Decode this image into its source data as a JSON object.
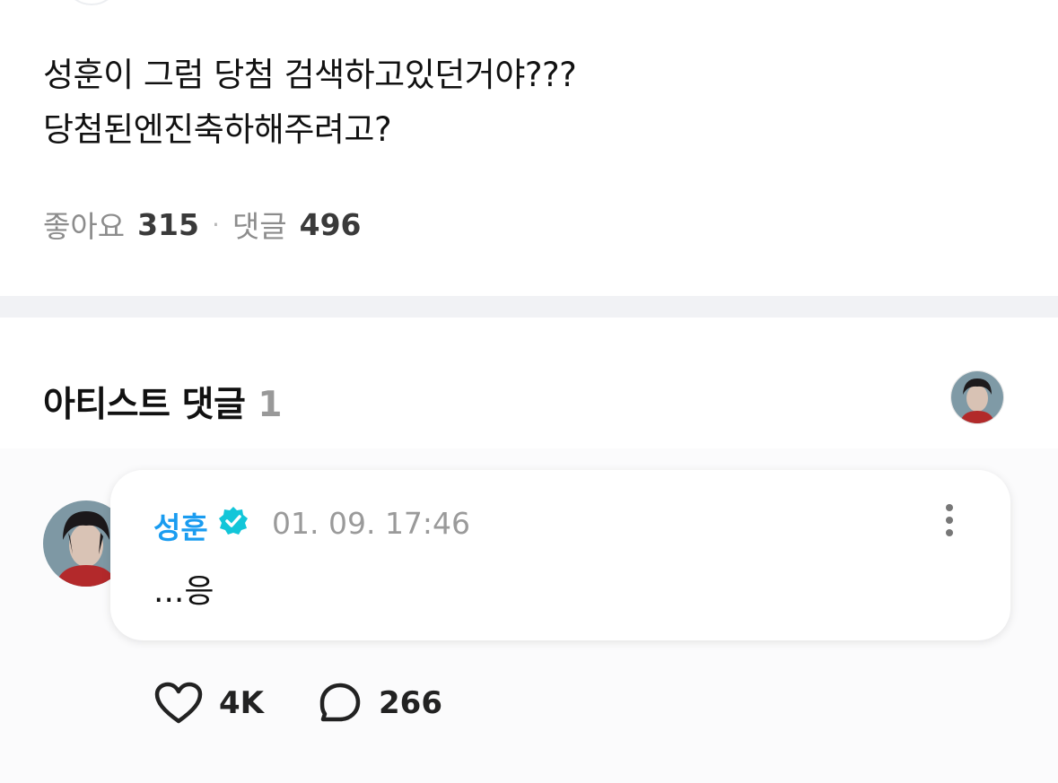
{
  "post": {
    "line1": "성훈이 그럼 당첨 검색하고있던거야???",
    "line2": "당첨된엔진축하해주려고?",
    "likes_label": "좋아요",
    "likes_count": "315",
    "separator": "·",
    "comments_label": "댓글",
    "comments_count": "496"
  },
  "artist_comments": {
    "title": "아티스트 댓글",
    "count": "1",
    "comment": {
      "author": "성훈",
      "verified": true,
      "timestamp": "01. 09. 17:46",
      "text": "...응",
      "like_count": "4K",
      "reply_count": "266"
    }
  },
  "icons": {
    "verified": "verified-badge-icon",
    "more": "more-vertical-icon",
    "like": "heart-icon",
    "reply": "speech-bubble-icon"
  },
  "colors": {
    "author": "#1a9cf0",
    "verified_badge": "#12c6d9",
    "divider": "#f1f2f5"
  }
}
